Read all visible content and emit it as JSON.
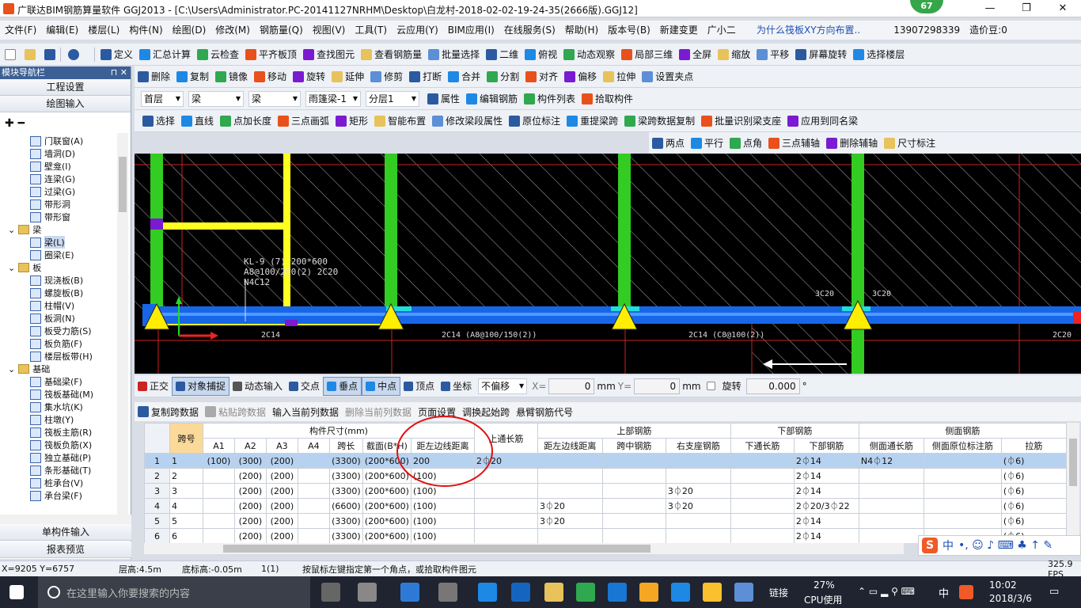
{
  "window": {
    "title": "广联达BIM钢筋算量软件 GGJ2013 - [C:\\Users\\Administrator.PC-20141127NRHM\\Desktop\\白龙村-2018-02-02-19-24-35(2666版).GGJ12]",
    "badge": "67",
    "min": "—",
    "max": "❐",
    "close": "✕"
  },
  "menu": [
    "文件(F)",
    "编辑(E)",
    "楼层(L)",
    "构件(N)",
    "绘图(D)",
    "修改(M)",
    "钢筋量(Q)",
    "视图(V)",
    "工具(T)",
    "云应用(Y)",
    "BIM应用(I)",
    "在线服务(S)",
    "帮助(H)",
    "版本号(B)",
    "新建变更",
    "广小二"
  ],
  "menu_right": {
    "question": "为什么筏板XY方向布置..",
    "phone": "13907298339",
    "price": "造价豆:0"
  },
  "toolbar1": [
    "定义",
    "汇总计算",
    "云检查",
    "平齐板顶",
    "查找图元",
    "查看钢筋量",
    "批量选择",
    "二维",
    "俯视",
    "动态观察",
    "局部三维",
    "全屏",
    "缩放",
    "平移",
    "屏幕旋转",
    "选择楼层"
  ],
  "toolbar2": [
    "删除",
    "复制",
    "镜像",
    "移动",
    "旋转",
    "延伸",
    "修剪",
    "打断",
    "合并",
    "分割",
    "对齐",
    "偏移",
    "拉伸",
    "设置夹点"
  ],
  "toolbar3": {
    "floor": "首层",
    "cat": "梁",
    "type": "梁",
    "comp": "雨篷梁-1",
    "layer": "分层1",
    "items": [
      "属性",
      "编辑钢筋",
      "构件列表",
      "拾取构件"
    ]
  },
  "toolbar4": [
    "选择",
    "直线",
    "点加长度",
    "三点画弧",
    "矩形",
    "智能布置",
    "修改梁段属性",
    "原位标注",
    "重提梁跨",
    "梁跨数据复制",
    "批量识别梁支座",
    "应用到同名梁"
  ],
  "toolbar5": [
    "两点",
    "平行",
    "点角",
    "三点辅轴",
    "删除辅轴",
    "尺寸标注"
  ],
  "nav": {
    "title": "模块导航栏",
    "pin": "✕",
    "btn1": "工程设置",
    "btn2": "绘图输入",
    "btn3": "单构件输入",
    "btn4": "报表预览",
    "items": [
      {
        "label": "门联窗(A)",
        "type": "item"
      },
      {
        "label": "墙洞(D)",
        "type": "item"
      },
      {
        "label": "壁龛(I)",
        "type": "item"
      },
      {
        "label": "连梁(G)",
        "type": "item"
      },
      {
        "label": "过梁(G)",
        "type": "item"
      },
      {
        "label": "带形洞",
        "type": "item"
      },
      {
        "label": "带形窗",
        "type": "item"
      },
      {
        "label": "梁",
        "type": "folder"
      },
      {
        "label": "梁(L)",
        "type": "item"
      },
      {
        "label": "圈梁(E)",
        "type": "item"
      },
      {
        "label": "板",
        "type": "folder"
      },
      {
        "label": "现浇板(B)",
        "type": "item"
      },
      {
        "label": "螺旋板(B)",
        "type": "item"
      },
      {
        "label": "柱帽(V)",
        "type": "item"
      },
      {
        "label": "板洞(N)",
        "type": "item"
      },
      {
        "label": "板受力筋(S)",
        "type": "item"
      },
      {
        "label": "板负筋(F)",
        "type": "item"
      },
      {
        "label": "楼层板带(H)",
        "type": "item"
      },
      {
        "label": "基础",
        "type": "folder"
      },
      {
        "label": "基础梁(F)",
        "type": "item"
      },
      {
        "label": "筏板基础(M)",
        "type": "item"
      },
      {
        "label": "集水坑(K)",
        "type": "item"
      },
      {
        "label": "柱墩(Y)",
        "type": "item"
      },
      {
        "label": "筏板主筋(R)",
        "type": "item"
      },
      {
        "label": "筏板负筋(X)",
        "type": "item"
      },
      {
        "label": "独立基础(P)",
        "type": "item"
      },
      {
        "label": "条形基础(T)",
        "type": "item"
      },
      {
        "label": "桩承台(V)",
        "type": "item"
      },
      {
        "label": "承台梁(F)",
        "type": "item"
      }
    ]
  },
  "canvas": {
    "t1": "KL-9 (7) 200*600",
    "t2": "A8@100/200(2) 2C20",
    "t3": "N4C12",
    "b1": "2C14",
    "b2": "2C14 (A8@100/150(2))",
    "b3": "2C14 (C8@100(2))",
    "b4": "2C20",
    "s1": "3C20",
    "s2": "3C20"
  },
  "snap": {
    "items": [
      "正交",
      "对象捕捉",
      "动态输入",
      "交点",
      "垂点",
      "中点",
      "顶点",
      "坐标"
    ],
    "offset": "不偏移",
    "xlabel": "X=",
    "x": "0",
    "ylabel": "Y=",
    "y": "0",
    "unit": "mm",
    "rot": "旋转",
    "rotval": "0.000",
    "deg": "°"
  },
  "tabletools": [
    "复制跨数据",
    "粘贴跨数据",
    "输入当前列数据",
    "删除当前列数据",
    "页面设置",
    "调换起始跨",
    "悬臂钢筋代号"
  ],
  "table": {
    "group_headers": [
      "构件尺寸(mm)",
      "上通长筋",
      "上部钢筋",
      "下部钢筋",
      "侧面钢筋"
    ],
    "headers": [
      "跨号",
      "A1",
      "A2",
      "A3",
      "A4",
      "跨长",
      "截面(B*H)",
      "距左边线距离",
      "左支座钢筋",
      "跨中钢筋",
      "右支座钢筋",
      "下通长筋",
      "下部钢筋",
      "侧面通长筋",
      "侧面原位标注筋",
      "拉筋"
    ],
    "rows": [
      [
        "1",
        "1",
        "(100)",
        "(300)",
        "(200)",
        "",
        "(3300)",
        "(200*600)",
        "200",
        "2⏀20",
        "",
        "",
        "",
        "",
        "2⏀14",
        "N4⏀12",
        "",
        "(⏀6)"
      ],
      [
        "2",
        "2",
        "",
        "(200)",
        "(200)",
        "",
        "(3300)",
        "(200*600)",
        "(100)",
        "",
        "",
        "",
        "",
        "",
        "2⏀14",
        "",
        "",
        "(⏀6)"
      ],
      [
        "3",
        "3",
        "",
        "(200)",
        "(200)",
        "",
        "(3300)",
        "(200*600)",
        "(100)",
        "",
        "",
        "",
        "3⏀20",
        "",
        "2⏀14",
        "",
        "",
        "(⏀6)"
      ],
      [
        "4",
        "4",
        "",
        "(200)",
        "(200)",
        "",
        "(6600)",
        "(200*600)",
        "(100)",
        "",
        "3⏀20",
        "",
        "3⏀20",
        "",
        "2⏀20/3⏀22",
        "",
        "",
        "(⏀6)"
      ],
      [
        "5",
        "5",
        "",
        "(200)",
        "(200)",
        "",
        "(3300)",
        "(200*600)",
        "(100)",
        "",
        "3⏀20",
        "",
        "",
        "",
        "2⏀14",
        "",
        "",
        "(⏀6)"
      ],
      [
        "6",
        "6",
        "",
        "(200)",
        "(200)",
        "",
        "(3300)",
        "(200*600)",
        "(100)",
        "",
        "",
        "",
        "",
        "",
        "2⏀14",
        "",
        "",
        "(⏀6)"
      ]
    ]
  },
  "status": {
    "coords": "X=9205 Y=6757",
    "floor_h": "层高:4.5m",
    "base_h": "底标高:-0.05m",
    "count": "1(1)",
    "hint": "按鼠标左键指定第一个角点，或拾取构件图元",
    "fps": "325.9 FPS"
  },
  "taskbar": {
    "search": "在这里输入你要搜索的内容",
    "link": "链接",
    "cpu": "27%",
    "cpu_label": "CPU使用",
    "ime": "中",
    "time": "10:02",
    "date": "2018/3/6"
  },
  "ime_bar": "中"
}
